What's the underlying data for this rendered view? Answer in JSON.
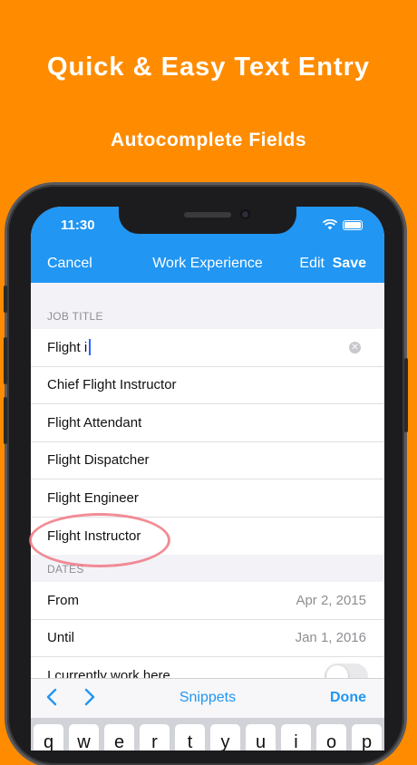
{
  "promo": {
    "headline": "Quick & Easy Text Entry",
    "subhead": "Autocomplete Fields"
  },
  "status_bar": {
    "time": "11:30"
  },
  "navbar": {
    "cancel": "Cancel",
    "title": "Work Experience",
    "edit": "Edit",
    "save": "Save"
  },
  "job_title": {
    "header": "JOB TITLE",
    "input_value": "Flight i",
    "suggestions": [
      "Chief Flight Instructor",
      "Flight Attendant",
      "Flight Dispatcher",
      "Flight Engineer",
      "Flight Instructor"
    ]
  },
  "dates": {
    "header": "DATES",
    "from_label": "From",
    "from_value": "Apr 2, 2015",
    "until_label": "Until",
    "until_value": "Jan 1, 2016",
    "current_label": "I currently work here"
  },
  "toolbar": {
    "prev_icon": "chevron-left-icon",
    "next_icon": "chevron-right-icon",
    "snippets": "Snippets",
    "done": "Done"
  },
  "keyboard": {
    "keys": [
      "q",
      "w",
      "e",
      "r",
      "t",
      "y",
      "u",
      "i",
      "o",
      "p"
    ]
  },
  "colors": {
    "background": "#FF8C00",
    "accent": "#2196F3",
    "highlight": "#F07882"
  }
}
